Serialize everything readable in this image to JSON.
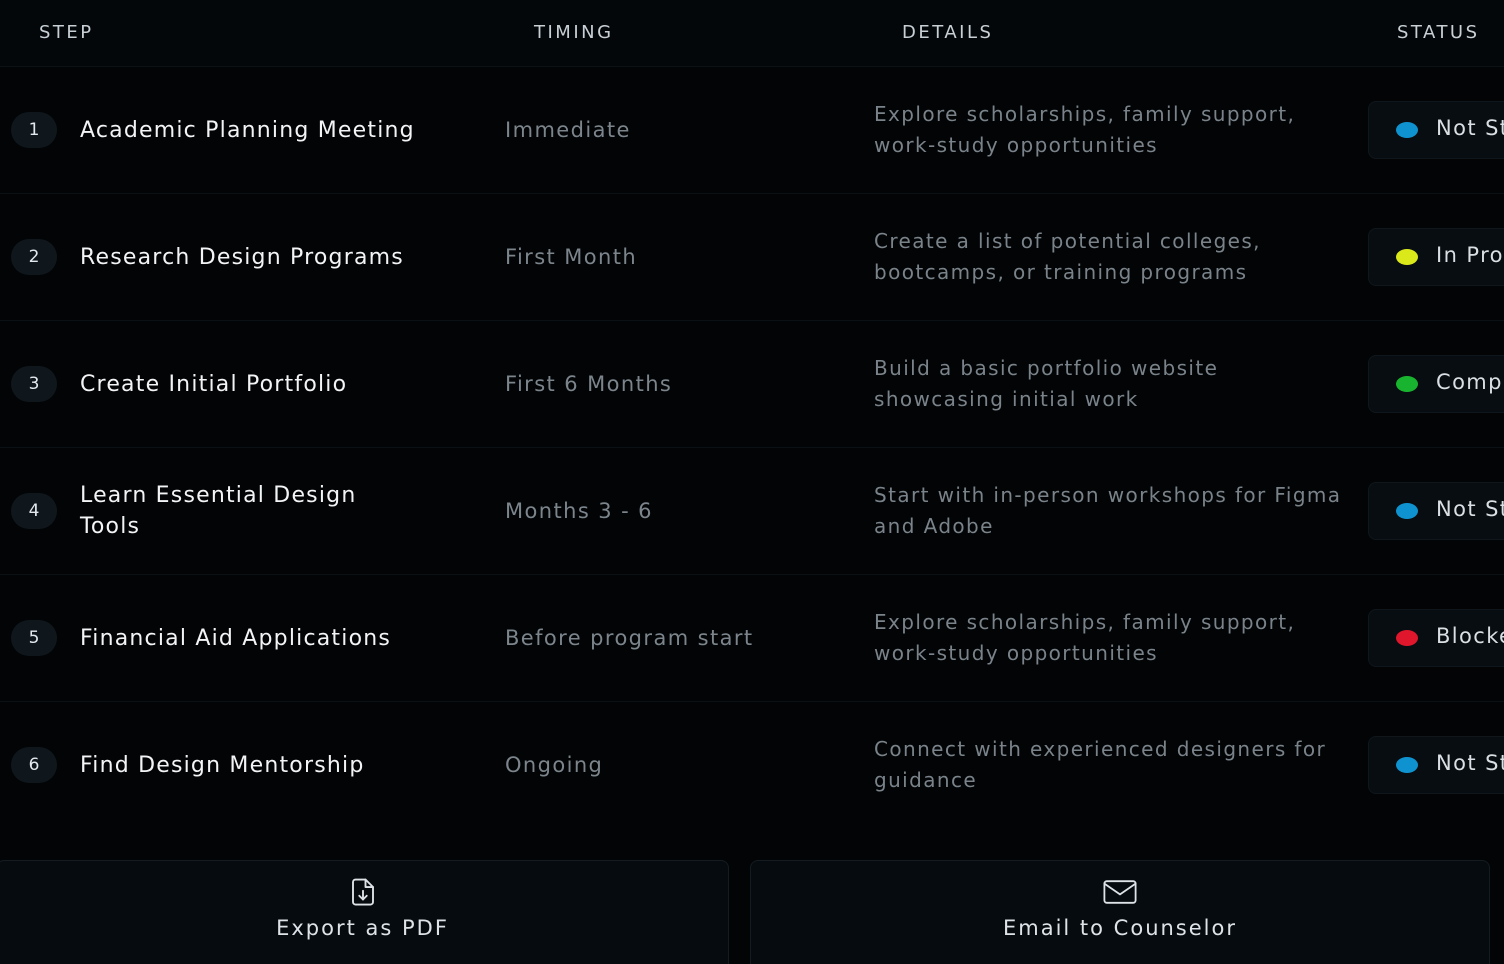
{
  "table": {
    "headers": {
      "step": "STEP",
      "timing": "TIMING",
      "details": "DETAILS",
      "status": "STATUS"
    },
    "rows": [
      {
        "num": "1",
        "step": "Academic Planning Meeting",
        "timing": "Immediate",
        "details": "Explore scholarships, family support, work-study opportunities",
        "status": "Not Started",
        "status_color": "#0f93d0"
      },
      {
        "num": "2",
        "step": "Research Design Programs",
        "timing": "First Month",
        "details": "Create a list of potential colleges, bootcamps, or training programs",
        "status": "In Progress",
        "status_color": "#dbe81a"
      },
      {
        "num": "3",
        "step": "Create Initial Portfolio",
        "timing": "First 6 Months",
        "details": "Build a basic portfolio website showcasing initial work",
        "status": "Completed",
        "status_color": "#19b42f"
      },
      {
        "num": "4",
        "step": "Learn Essential Design Tools",
        "timing": "Months 3 - 6",
        "details": "Start with in-person workshops for Figma and Adobe",
        "status": "Not Started",
        "status_color": "#0f93d0"
      },
      {
        "num": "5",
        "step": "Financial Aid Applications",
        "timing": "Before program start",
        "details": "Explore scholarships, family support, work-study opportunities",
        "status": "Blocked",
        "status_color": "#e0162c"
      },
      {
        "num": "6",
        "step": "Find Design Mentorship",
        "timing": "Ongoing",
        "details": "Connect with experienced designers for guidance",
        "status": "Not Started",
        "status_color": "#0f93d0"
      }
    ]
  },
  "actions": {
    "export_label": "Export as PDF",
    "export_icon": "file-download-icon",
    "email_label": "Email to Counselor",
    "email_icon": "mail-icon"
  }
}
